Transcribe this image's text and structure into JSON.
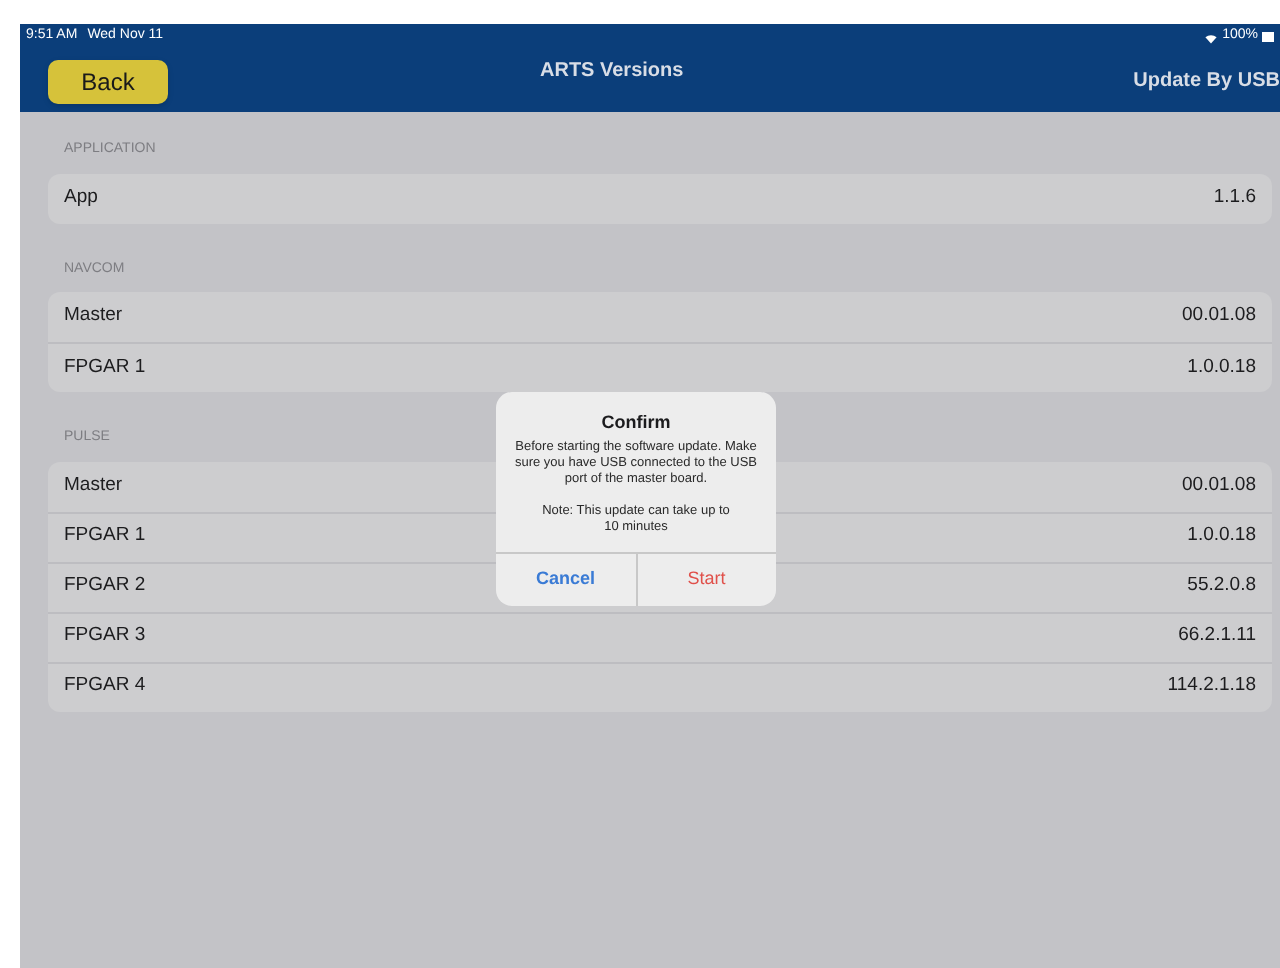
{
  "status_bar": {
    "time": "9:51 AM",
    "date": "Wed Nov 11",
    "battery": "100%"
  },
  "nav": {
    "back": "Back",
    "title": "ARTS Versions",
    "action": "Update By USB"
  },
  "sections": [
    {
      "header": "APPLICATION",
      "rows": [
        {
          "label": "App",
          "value": "1.1.6"
        }
      ]
    },
    {
      "header": "NAVCOM",
      "rows": [
        {
          "label": "Master",
          "value": "00.01.08"
        },
        {
          "label": "FPGAR 1",
          "value": "1.0.0.18"
        }
      ]
    },
    {
      "header": "PULSE",
      "rows": [
        {
          "label": "Master",
          "value": "00.01.08"
        },
        {
          "label": "FPGAR 1",
          "value": "1.0.0.18"
        },
        {
          "label": "FPGAR 2",
          "value": "55.2.0.8"
        },
        {
          "label": "FPGAR 3",
          "value": "66.2.1.11"
        },
        {
          "label": "FPGAR 4",
          "value": "114.2.1.18"
        }
      ]
    }
  ],
  "dialog": {
    "title": "Confirm",
    "message": "Before starting the software update. Make sure you have USB connected to the USB port of the master board.",
    "note": "Note: This update can take up to 10 minutes",
    "buttons": [
      {
        "label": "Cancel",
        "kind": "cancel"
      },
      {
        "label": "Start",
        "kind": "destructive"
      }
    ]
  }
}
